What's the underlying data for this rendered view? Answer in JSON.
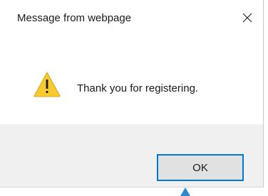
{
  "dialog": {
    "title": "Message from webpage",
    "close_icon": "close-icon",
    "message": "Thank you for registering.",
    "icon": "warning-icon",
    "ok_label": "OK"
  },
  "colors": {
    "accent": "#0078d7",
    "warning_fill": "#f7cb2f",
    "footer_bg": "#f0f0f0",
    "button_bg": "#e1e1e1"
  }
}
